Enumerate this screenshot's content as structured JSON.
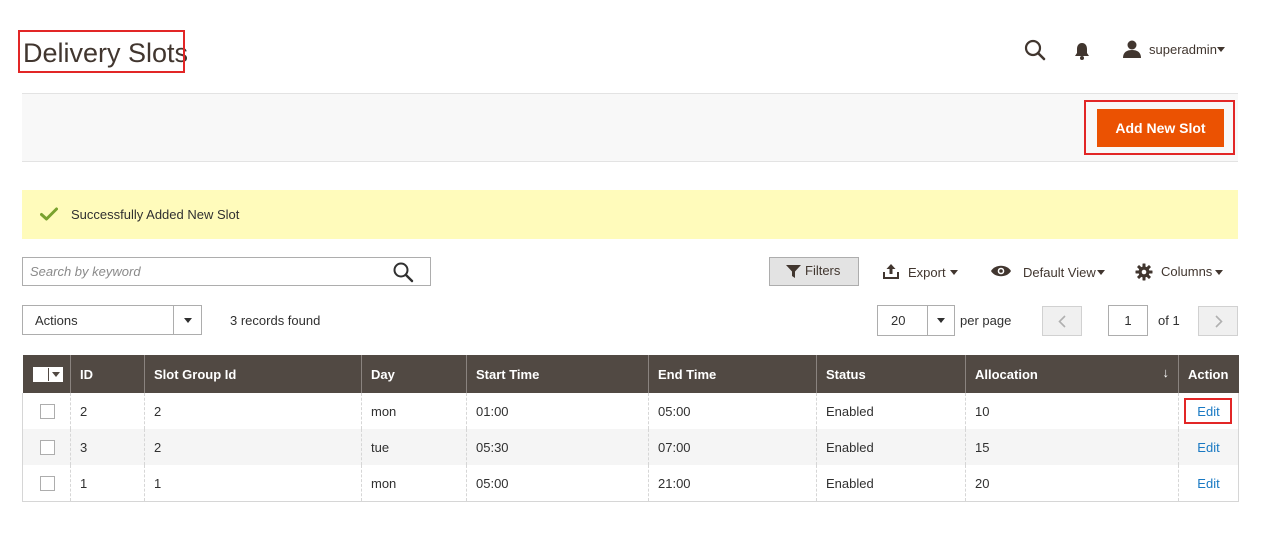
{
  "header": {
    "page_title": "Delivery Slots",
    "user_name": "superadmin",
    "search_icon": "search-icon",
    "notification_icon": "bell-icon",
    "user_icon": "user-icon"
  },
  "action_bar": {
    "add_button_label": "Add New Slot",
    "add_button_color": "#eb5202"
  },
  "message": {
    "text": "Successfully Added New Slot",
    "icon": "check-icon",
    "bg_color": "#fffbbb",
    "icon_color": "#79a22e"
  },
  "toolbar": {
    "search_placeholder": "Search by keyword",
    "filters_label": "Filters",
    "export_label": "Export",
    "view_label": "Default View",
    "columns_label": "Columns"
  },
  "grid_controls": {
    "actions_label": "Actions",
    "records_found": "3 records found",
    "per_page_value": "20",
    "per_page_label": "per page",
    "current_page": "1",
    "of_pages": "of 1"
  },
  "grid": {
    "header_color": "#514943",
    "columns": [
      "ID",
      "Slot Group Id",
      "Day",
      "Start Time",
      "End Time",
      "Status",
      "Allocation",
      "Action"
    ],
    "sort_indicator": "↓",
    "rows": [
      {
        "id": "2",
        "slot_group_id": "2",
        "day": "mon",
        "start_time": "01:00",
        "end_time": "05:00",
        "status": "Enabled",
        "allocation": "10",
        "action": "Edit"
      },
      {
        "id": "3",
        "slot_group_id": "2",
        "day": "tue",
        "start_time": "05:30",
        "end_time": "07:00",
        "status": "Enabled",
        "allocation": "15",
        "action": "Edit"
      },
      {
        "id": "1",
        "slot_group_id": "1",
        "day": "mon",
        "start_time": "05:00",
        "end_time": "21:00",
        "status": "Enabled",
        "allocation": "20",
        "action": "Edit"
      }
    ]
  }
}
